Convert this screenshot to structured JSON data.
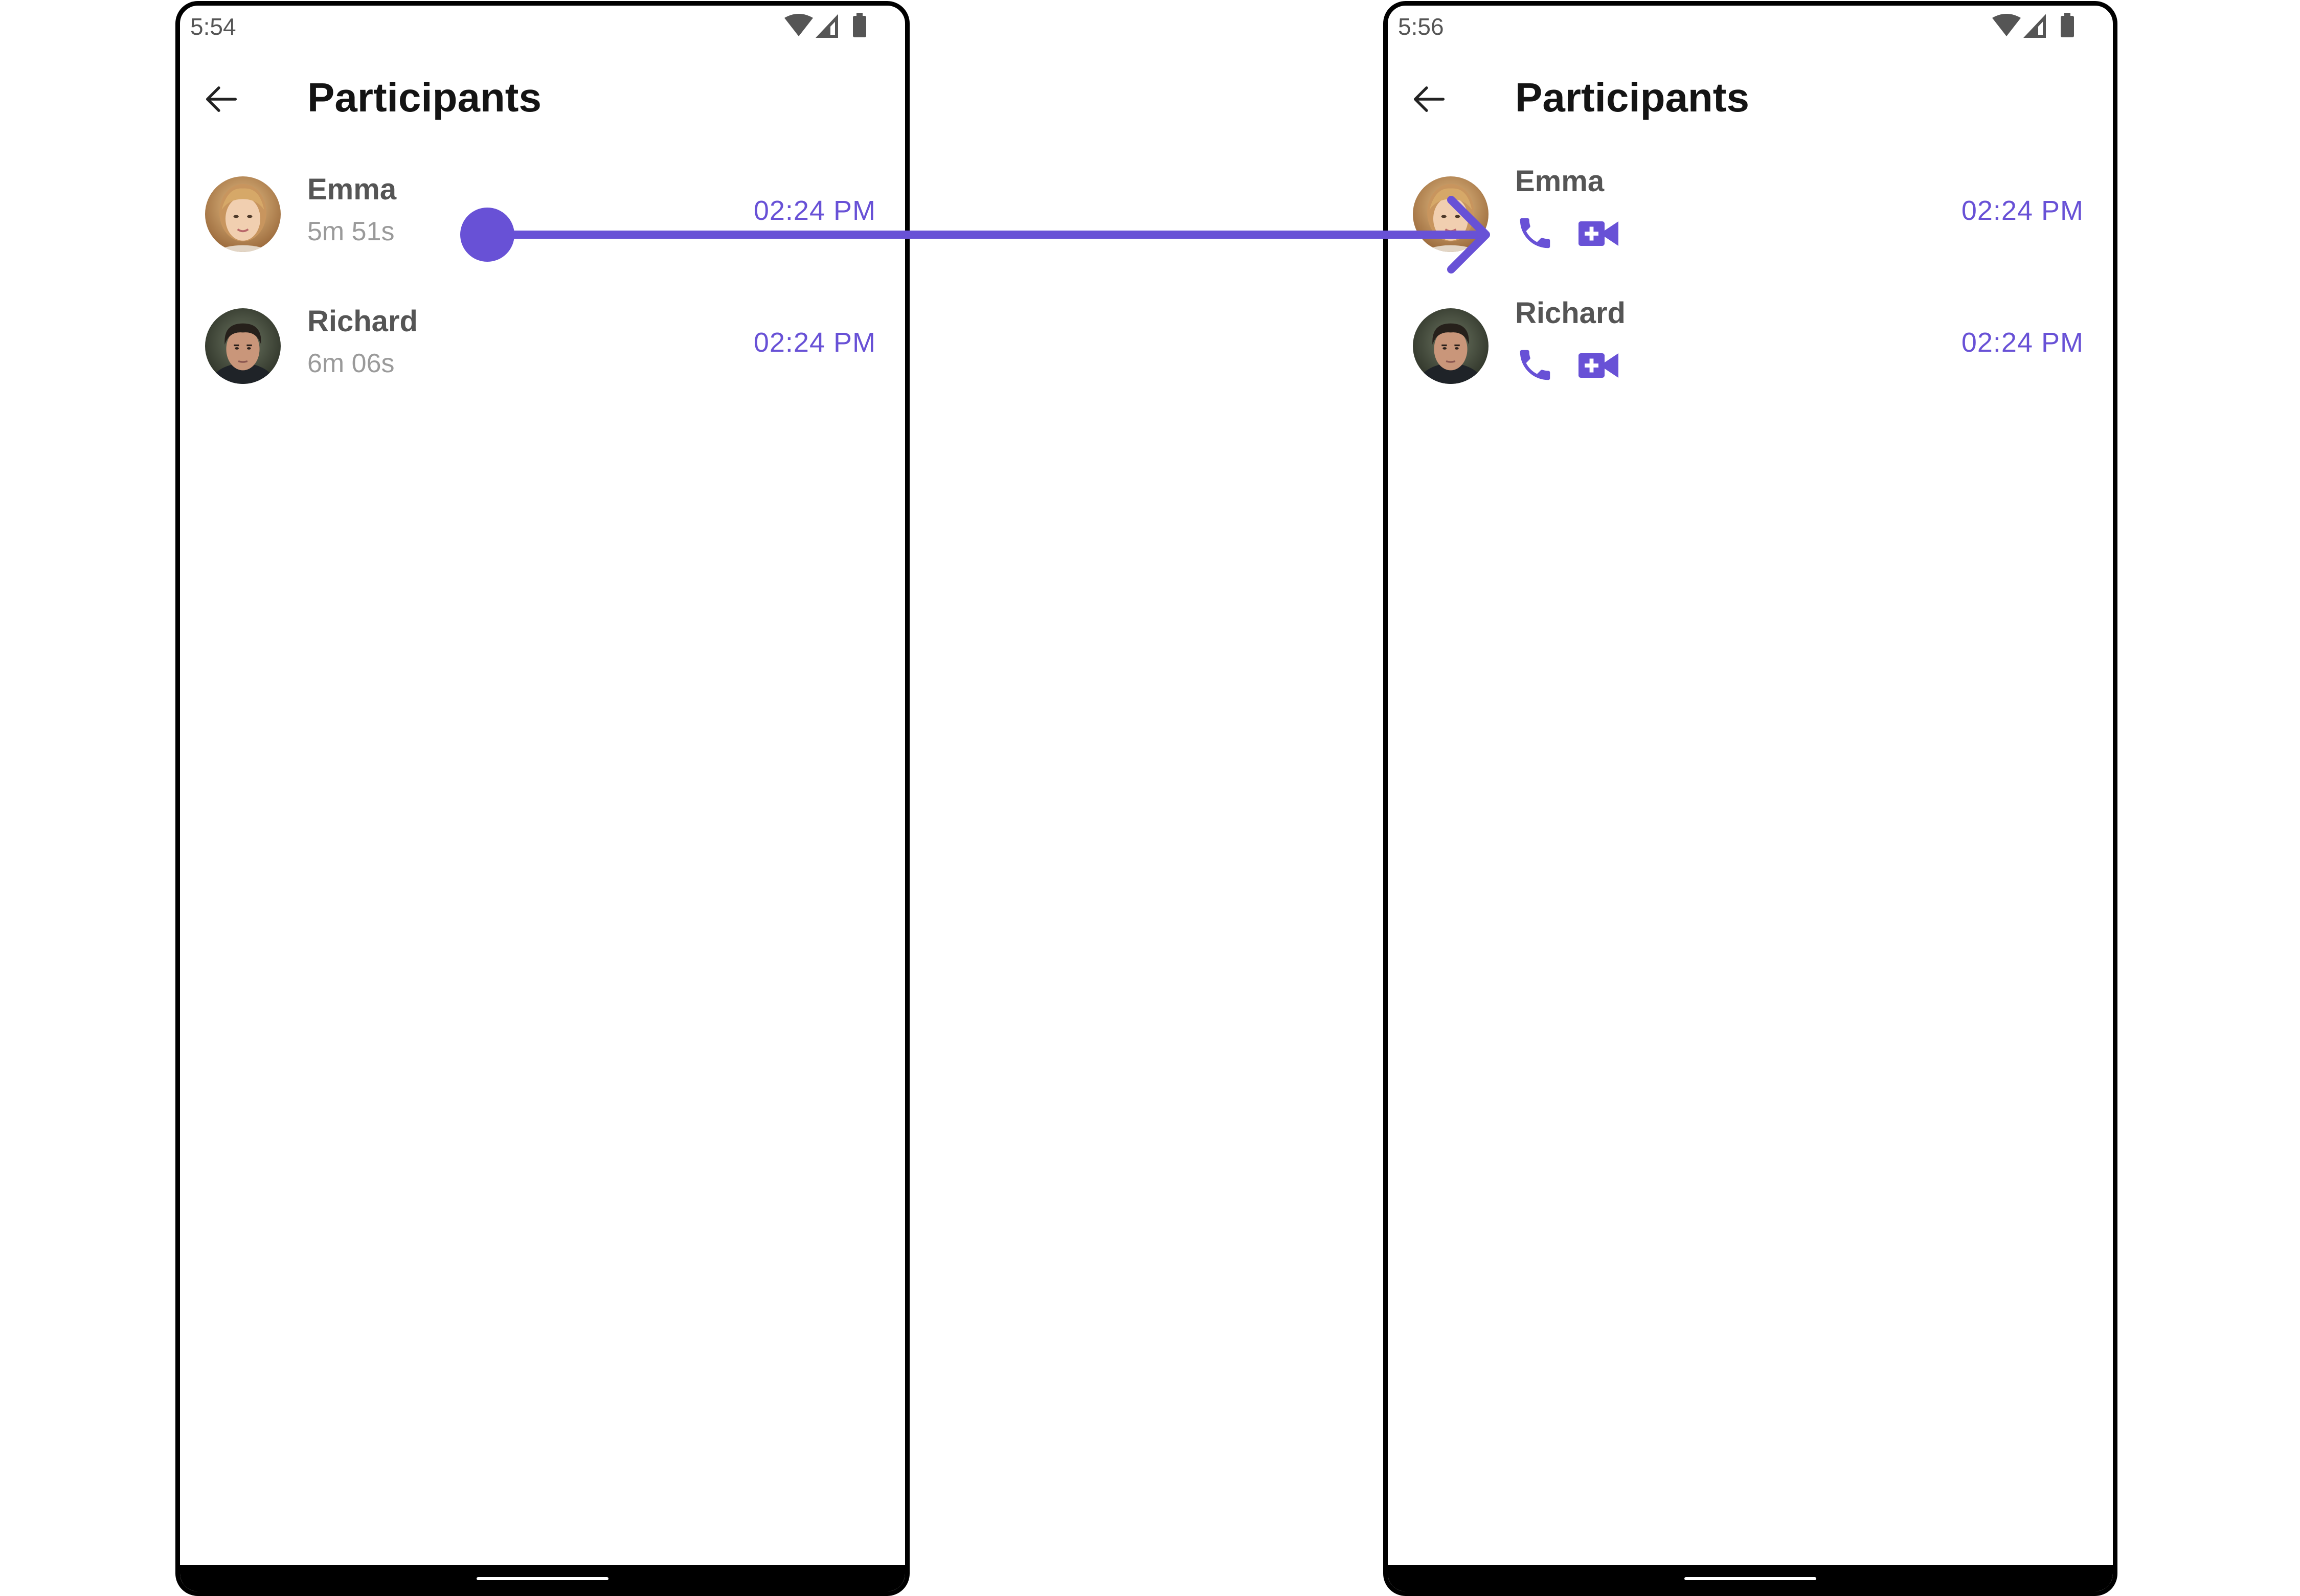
{
  "accent_color": "#6851d6",
  "screens": [
    {
      "status_time": "5:54",
      "status_icons": [
        "wifi-icon",
        "signal-icon",
        "battery-icon"
      ],
      "title": "Participants",
      "back_icon": "arrow-left-icon",
      "participants": [
        {
          "name": "Emma",
          "duration": "5m 51s",
          "time": "02:24 PM"
        },
        {
          "name": "Richard",
          "duration": "6m 06s",
          "time": "02:24 PM"
        }
      ]
    },
    {
      "status_time": "5:56",
      "status_icons": [
        "wifi-icon",
        "signal-icon",
        "battery-icon"
      ],
      "title": "Participants",
      "back_icon": "arrow-left-icon",
      "participants": [
        {
          "name": "Emma",
          "time": "02:24 PM",
          "actions": [
            "phone-icon",
            "video-call-icon"
          ]
        },
        {
          "name": "Richard",
          "time": "02:24 PM",
          "actions": [
            "phone-icon",
            "video-call-icon"
          ]
        }
      ]
    }
  ],
  "gesture": {
    "type": "swipe-right",
    "icon": "swipe-arrow-icon"
  }
}
